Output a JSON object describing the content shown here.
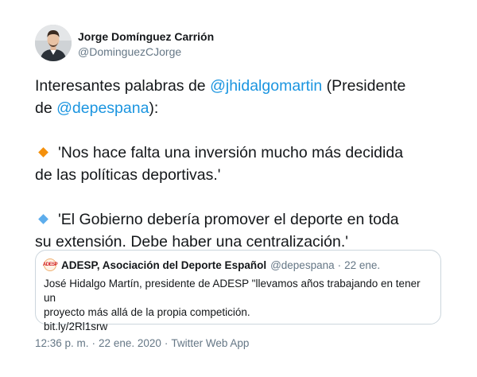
{
  "author": {
    "display_name": "Jorge Domínguez Carrión",
    "handle": "@DominguezCJorge",
    "avatar_icon": "profile-photo"
  },
  "tweet": {
    "line1_prefix": "Interesantes palabras de ",
    "line1_mention": "@jhidalgomartin",
    "line1_suffix": " (Presidente",
    "line2_prefix": "de ",
    "line2_mention": "@depespana",
    "line2_suffix": "):",
    "quote1_icon": "small-orange-diamond",
    "quote1_line1": "'Nos hace falta una inversión mucho más decidida",
    "quote1_line2": "de las políticas deportivas.'",
    "quote2_icon": "small-blue-diamond",
    "quote2_line1": "'El Gobierno debería promover el deporte en toda",
    "quote2_line2": "su extensión. Debe haber una centralización.'"
  },
  "quoted_tweet": {
    "avatar_text": "ADESP",
    "name": "ADESP, Asociación del Deporte Español",
    "handle": "@depespana",
    "separator": "·",
    "date": "22 ene.",
    "text_line1": "José Hidalgo Martín, presidente de ADESP \"llevamos años trabajando en tener un",
    "text_line2": "proyecto más allá de la propia competición.",
    "link": "bit.ly/2Rl1srw"
  },
  "meta": {
    "time": "12:36 p. m.",
    "separator": "·",
    "date": "22 ene. 2020",
    "source": "Twitter Web App"
  },
  "colors": {
    "link": "#1b95e0",
    "secondary_text": "#657786",
    "primary_text": "#14171a",
    "border": "#ccd6dd",
    "diamond_orange": "#f4900c",
    "diamond_blue": "#5dadec"
  }
}
